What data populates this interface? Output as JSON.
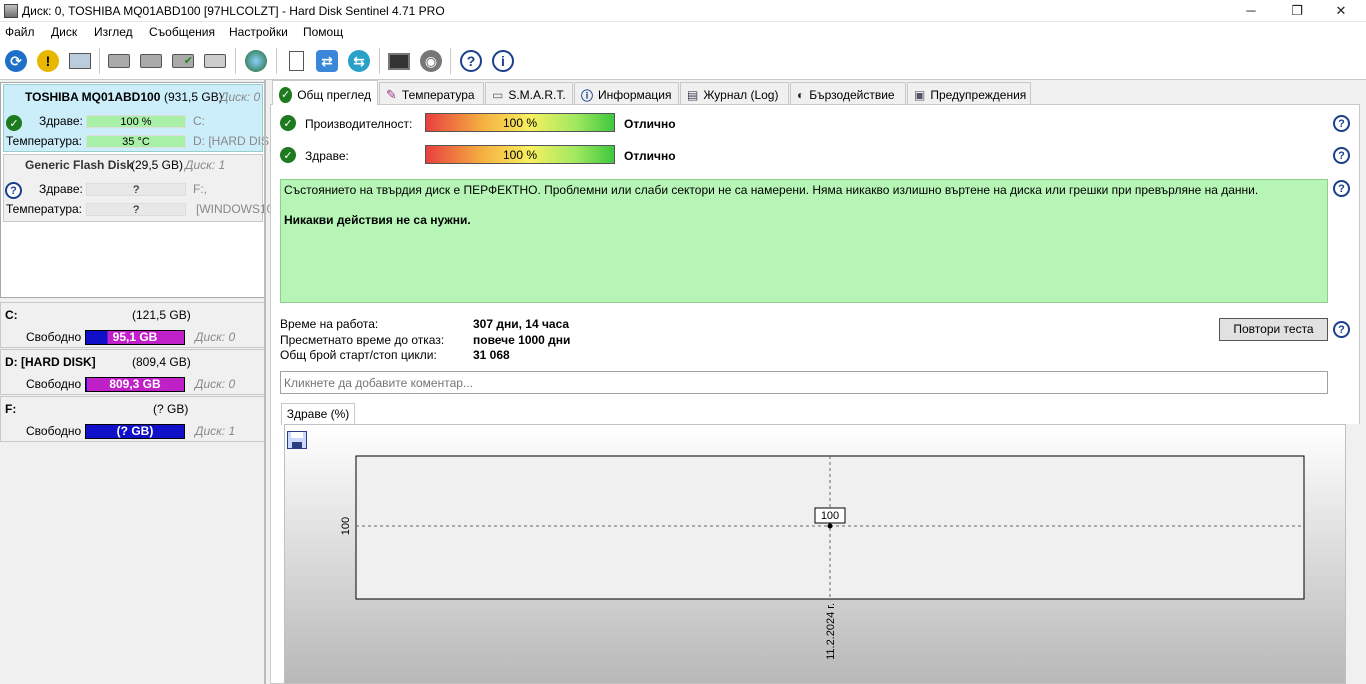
{
  "window": {
    "title": "Диск: 0, TOSHIBA MQ01ABD100 [97HLCOLZT]  -  Hard Disk Sentinel 4.71 PRO",
    "minimize": "─",
    "maximize": "❐",
    "close": "✕"
  },
  "menu": [
    "Файл",
    "Диск",
    "Изглед",
    "Съобщения",
    "Настройки",
    "Помощ"
  ],
  "toolbar_icons": [
    "refresh-icon",
    "warning-icon",
    "disk-info-icon",
    "hdd-icon",
    "hdd-icon",
    "hdd-check-icon",
    "hdd-icon",
    "globe-icon",
    "document-icon",
    "sync-icon",
    "network-icon",
    "monitor-icon",
    "speaker-icon",
    "help-icon",
    "info-icon"
  ],
  "disks": [
    {
      "name": "TOSHIBA MQ01ABD100",
      "size": "(931,5 GB)",
      "disk": "Диск: 0",
      "health_label": "Здраве:",
      "health": "100 %",
      "health_drive": "C:",
      "temp_label": "Температура:",
      "temp": "35 °C",
      "temp_drive": "D: [HARD DIS"
    },
    {
      "name": "Generic Flash Disk",
      "size": "(29,5 GB)",
      "disk": "Диск: 1",
      "health_label": "Здраве:",
      "health": "?",
      "health_drive": "F:,",
      "temp_label": "Температура:",
      "temp": "?",
      "temp_drive": "[WINDOWS10"
    }
  ],
  "partitions": [
    {
      "name": "C:",
      "size": "(121,5 GB)",
      "free_label": "Свободно",
      "free": "95,1 GB",
      "disk": "Диск: 0"
    },
    {
      "name": "D: [HARD DISK]",
      "size": "(809,4 GB)",
      "free_label": "Свободно",
      "free": "809,3 GB",
      "disk": "Диск: 0"
    },
    {
      "name": "F:",
      "size": "(? GB)",
      "free_label": "Свободно",
      "free": "(? GB)",
      "disk": "Диск: 1"
    }
  ],
  "tabs": [
    "Общ преглед",
    "Температура",
    "S.M.A.R.T.",
    "Информация",
    "Журнал (Log)",
    "Бързодействие",
    "Предупреждения"
  ],
  "overview": {
    "perf_label": "Производителност:",
    "perf_value": "100 %",
    "perf_rating": "Отлично",
    "health_label": "Здраве:",
    "health_value": "100 %",
    "health_rating": "Отлично",
    "status_text": "Състоянието на твърдия диск е ПЕРФЕКТНО. Проблемни или слаби сектори не са намерени. Няма никакво излишно въртене на диска или грешки при превърляне на данни.",
    "status_action": "Никакви действия не са нужни.",
    "uptime_label": "Време на работа:",
    "uptime": "307 дни, 14 часа",
    "estimated_label": "Пресметнато време до отказ:",
    "estimated": "повече 1000 дни",
    "cycles_label": "Общ брой старт/стоп цикли:",
    "cycles": "31 068",
    "retest_button": "Повтори теста",
    "comment_placeholder": "Кликнете да добавите коментар..."
  },
  "chart_tab": "Здраве (%)",
  "chart_data": {
    "type": "line",
    "x": [
      "11.2.2024 г."
    ],
    "values": [
      100
    ],
    "ylabel": "100",
    "point_label": "100"
  }
}
